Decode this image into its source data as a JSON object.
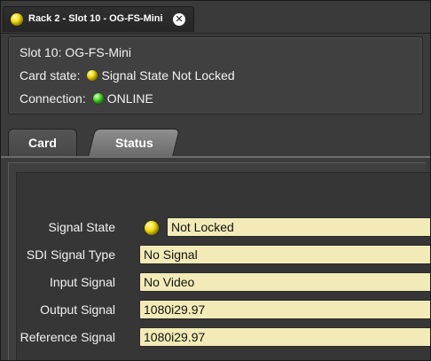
{
  "window": {
    "tab_title": "Rack 2 - Slot 10 - OG-FS-Mini",
    "tab_led_color": "#f2dc08",
    "close_icon": "close-icon",
    "close_glyph": "✕"
  },
  "info": {
    "slot_line": "Slot 10: OG-FS-Mini",
    "card_state_label": "Card state:",
    "card_state_led_color": "#f2dc08",
    "card_state_value": "Signal State Not Locked",
    "connection_label": "Connection:",
    "connection_led_color": "#3fd41c",
    "connection_value": "ONLINE"
  },
  "tabs": [
    {
      "label": "Card",
      "active": false
    },
    {
      "label": "Status",
      "active": true
    }
  ],
  "status": {
    "signal_state": {
      "label": "Signal State",
      "led_color": "#f2dc08",
      "value": "Not Locked"
    },
    "sdi_signal_type": {
      "label": "SDI Signal Type",
      "value": "No Signal"
    },
    "input_signal": {
      "label": "Input Signal",
      "value": "No Video"
    },
    "output_signal": {
      "label": "Output Signal",
      "value": "1080i29.97"
    },
    "reference_signal": {
      "label": "Reference Signal",
      "value": "1080i29.97"
    }
  },
  "colors": {
    "field_background": "#f3ebb7",
    "panel_background": "#3b3b3b"
  }
}
